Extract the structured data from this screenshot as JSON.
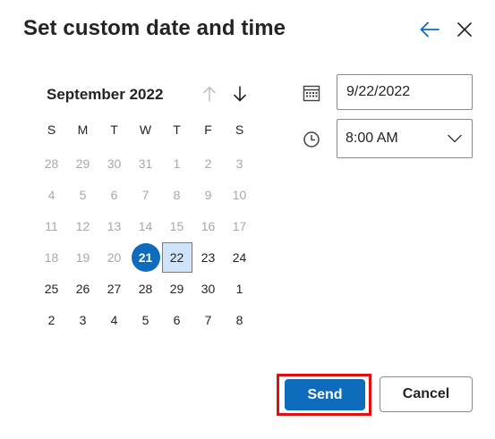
{
  "dialog": {
    "title": "Set custom date and time"
  },
  "header": {
    "back_icon": "arrow-left-icon",
    "close_icon": "close-icon"
  },
  "calendar": {
    "month_label": "September 2022",
    "weekdays": [
      "S",
      "M",
      "T",
      "W",
      "T",
      "F",
      "S"
    ],
    "weeks": [
      [
        "28",
        "29",
        "30",
        "31",
        "1",
        "2",
        "3"
      ],
      [
        "4",
        "5",
        "6",
        "7",
        "8",
        "9",
        "10"
      ],
      [
        "11",
        "12",
        "13",
        "14",
        "15",
        "16",
        "17"
      ],
      [
        "18",
        "19",
        "20",
        "21",
        "22",
        "23",
        "24"
      ],
      [
        "25",
        "26",
        "27",
        "28",
        "29",
        "30",
        "1"
      ],
      [
        "2",
        "3",
        "4",
        "5",
        "6",
        "7",
        "8"
      ]
    ],
    "today": "21",
    "selected": "22"
  },
  "date_field": {
    "value": "9/22/2022",
    "icon": "calendar-icon"
  },
  "time_field": {
    "value": "8:00 AM",
    "icon": "clock-icon"
  },
  "actions": {
    "send_label": "Send",
    "cancel_label": "Cancel"
  },
  "colors": {
    "accent": "#0f6cbd",
    "selected_bg": "#cfe4fa",
    "highlight_border": "#e01010",
    "muted_text": "#a8a8a8"
  }
}
